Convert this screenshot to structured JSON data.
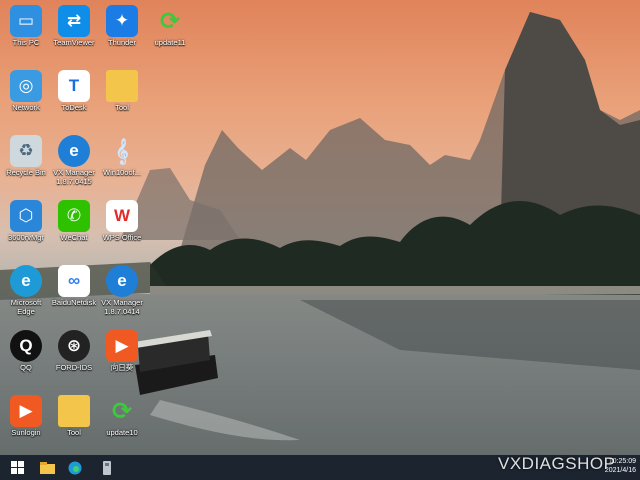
{
  "desktop_icons": [
    {
      "label": "This PC"
    },
    {
      "label": "TeamViewer"
    },
    {
      "label": "Thunder"
    },
    {
      "label": "update11"
    },
    {
      "label": "Network"
    },
    {
      "label": "ToDesk"
    },
    {
      "label": "Tool"
    },
    {
      "label": "Recycle Bin"
    },
    {
      "label": "VX Manager\n1.8.7.0415"
    },
    {
      "label": "Win10oof..."
    },
    {
      "label": "3600rvMgr"
    },
    {
      "label": "WeChat"
    },
    {
      "label": "WPS Office"
    },
    {
      "label": "Microsoft\nEdge"
    },
    {
      "label": "BaiduNetdisk"
    },
    {
      "label": "VX Manager\n1.8.7.0414"
    },
    {
      "label": "QQ"
    },
    {
      "label": "FORD-IDS"
    },
    {
      "label": "向日葵"
    },
    {
      "label": "Sunlogin"
    },
    {
      "label": "Tool"
    },
    {
      "label": "update10"
    }
  ],
  "taskbar": {
    "start_icon": "windows-start-icon",
    "apps": [
      "file-explorer-icon",
      "edge-icon",
      "usb-drive-icon"
    ],
    "tray_time": "10:25:09",
    "tray_date": "2021/4/16"
  },
  "watermark": "VXDIAGSHOP"
}
